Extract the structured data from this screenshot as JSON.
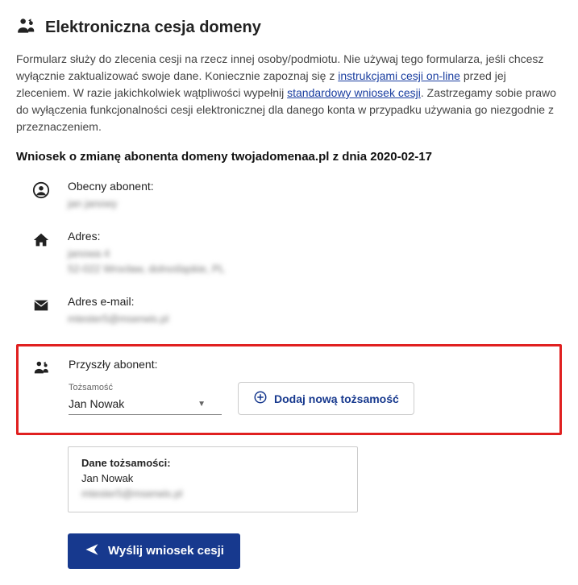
{
  "header": {
    "title": "Elektroniczna cesja domeny"
  },
  "intro": {
    "part1": "Formularz służy do zlecenia cesji na rzecz innej osoby/podmiotu. Nie używaj tego formularza, jeśli chcesz wyłącznie zaktualizować swoje dane. Koniecznie zapoznaj się z ",
    "link1": "instrukcjami cesji on-line",
    "part2": " przed jej zleceniem. W razie jakichkolwiek wątpliwości wypełnij ",
    "link2": "standardowy wniosek cesji",
    "part3": ". Zastrzegamy sobie prawo do wyłączenia funkcjonalności cesji elektronicznej dla danego konta w przypadku używania go niezgodnie z przeznaczeniem."
  },
  "subtitle": "Wniosek o zmianę abonenta domeny twojadomenaa.pl z dnia 2020-02-17",
  "current": {
    "label": "Obecny abonent:",
    "value": "jan janowy"
  },
  "address": {
    "label": "Adres:",
    "line1": "janowa 4",
    "line2": "52-022 Wrocław, dolnośląskie, PL"
  },
  "email": {
    "label": "Adres e-mail:",
    "value": "mtester5@mserwis.pl"
  },
  "future": {
    "label": "Przyszły abonent:",
    "select_label": "Tożsamość",
    "select_value": "Jan Nowak",
    "add_btn": "Dodaj nową tożsamość"
  },
  "identity_card": {
    "title": "Dane tożsamości:",
    "name": "Jan Nowak",
    "email": "mtester5@mserwis.pl"
  },
  "submit": {
    "label": "Wyślij wniosek cesji"
  }
}
